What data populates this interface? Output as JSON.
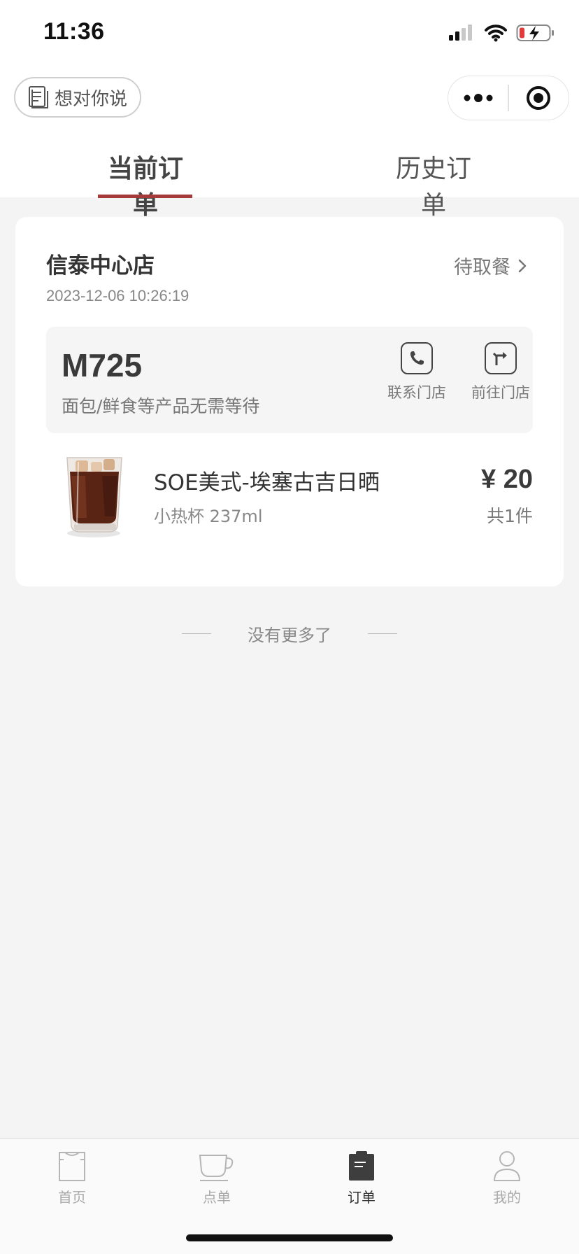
{
  "status_bar": {
    "time": "11:36"
  },
  "header": {
    "feedback_label": "想对你说",
    "more_icon": "more-dots-icon",
    "close_icon": "target-circle-icon"
  },
  "tabs": [
    {
      "label": "当前订单",
      "active": true
    },
    {
      "label": "历史订单",
      "active": false
    }
  ],
  "order": {
    "store_name": "信泰中心店",
    "status": "待取餐",
    "time": "2023-12-06 10:26:19",
    "pickup_code": "M725",
    "pickup_note": "面包/鲜食等产品无需等待",
    "actions": [
      {
        "label": "联系门店",
        "icon": "phone-icon"
      },
      {
        "label": "前往门店",
        "icon": "directions-icon"
      }
    ],
    "items": [
      {
        "name": "SOE美式-埃塞古吉日晒",
        "spec": "小热杯 237ml",
        "price": "¥ 20",
        "quantity": "共1件"
      }
    ]
  },
  "end_text": "没有更多了",
  "bottom_nav": [
    {
      "label": "首页",
      "icon": "tshirt-icon",
      "active": false
    },
    {
      "label": "点单",
      "icon": "coffee-cup-icon",
      "active": false
    },
    {
      "label": "订单",
      "icon": "clipboard-icon",
      "active": true
    },
    {
      "label": "我的",
      "icon": "person-icon",
      "active": false
    }
  ],
  "colors": {
    "accent": "#a63a3a",
    "background": "#f4f4f4",
    "card": "#ffffff"
  }
}
